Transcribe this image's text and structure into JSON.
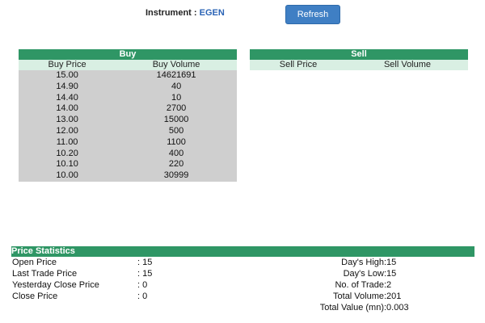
{
  "header": {
    "instrument_label": "Instrument :",
    "instrument_code": "EGEN",
    "refresh_label": "Refresh"
  },
  "buy": {
    "title": "Buy",
    "col_price": "Buy Price",
    "col_volume": "Buy Volume",
    "rows": [
      {
        "price": "15.00",
        "volume": "14621691"
      },
      {
        "price": "14.90",
        "volume": "40"
      },
      {
        "price": "14.40",
        "volume": "10"
      },
      {
        "price": "14.00",
        "volume": "2700"
      },
      {
        "price": "13.00",
        "volume": "15000"
      },
      {
        "price": "12.00",
        "volume": "500"
      },
      {
        "price": "11.00",
        "volume": "1100"
      },
      {
        "price": "10.20",
        "volume": "400"
      },
      {
        "price": "10.10",
        "volume": "220"
      },
      {
        "price": "10.00",
        "volume": "30999"
      }
    ]
  },
  "sell": {
    "title": "Sell",
    "col_price": "Sell Price",
    "col_volume": "Sell Volume"
  },
  "stats": {
    "title": "Price Statistics",
    "left": [
      {
        "label": "Open Price",
        "value": ": 15"
      },
      {
        "label": "Last Trade Price",
        "value": ": 15"
      },
      {
        "label": "Yesterday Close Price",
        "value": ": 0"
      },
      {
        "label": "Close Price",
        "value": ": 0"
      }
    ],
    "right": [
      {
        "label": "Day's High",
        "value": ":15"
      },
      {
        "label": "Day's Low",
        "value": ":15"
      },
      {
        "label": "No. of Trade",
        "value": ":2"
      },
      {
        "label": "Total Volume",
        "value": ":201"
      },
      {
        "label": "Total Value (mn)",
        "value": ":0.003"
      }
    ]
  },
  "colors": {
    "accent_green": "#2f9665",
    "header_green_light": "#d9efe3",
    "row_gray": "#cfcfcf",
    "button_blue": "#3f7fc4",
    "instrument_blue": "#2a63b5"
  }
}
